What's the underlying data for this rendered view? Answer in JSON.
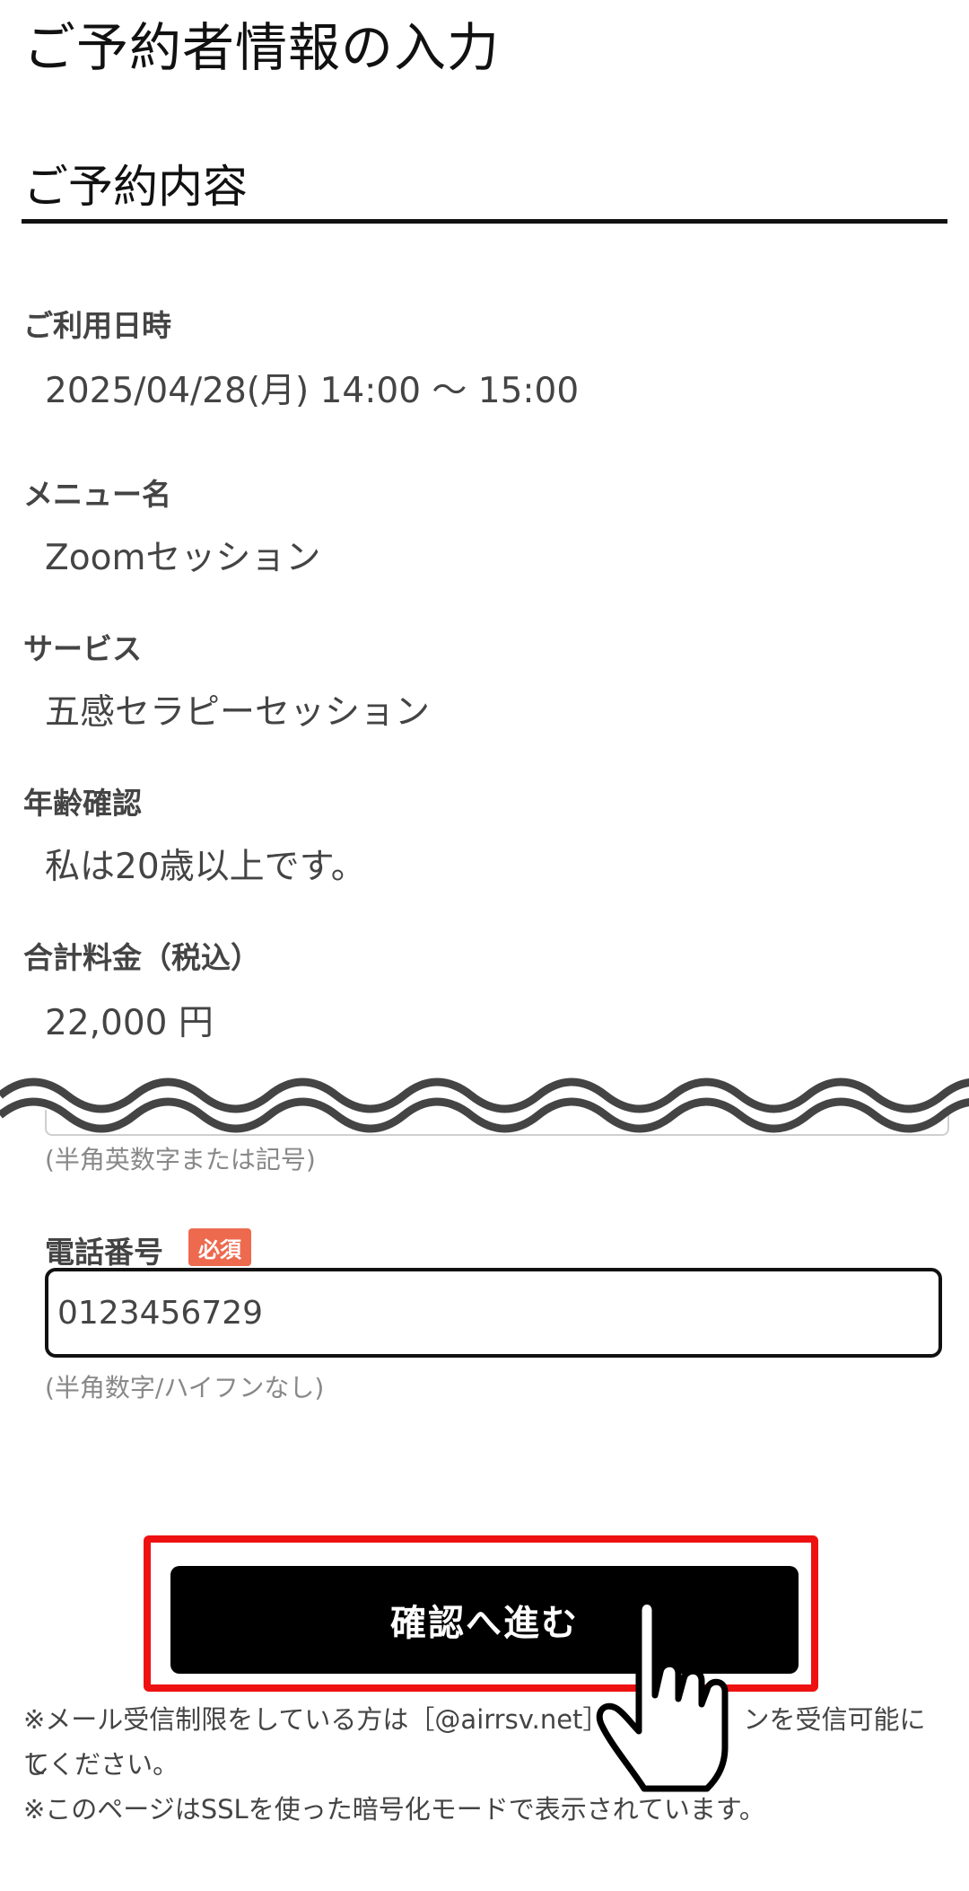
{
  "page": {
    "title": "ご予約者情報の入力"
  },
  "reservation": {
    "section_title": "ご予約内容",
    "fields": [
      {
        "label": "ご利用日時",
        "value": "2025/04/28(月) 14:00 〜 15:00"
      },
      {
        "label": "メニュー名",
        "value": "Zoomセッション"
      },
      {
        "label": "サービス",
        "value": "五感セラピーセッション"
      },
      {
        "label": "年齢確認",
        "value": "私は20歳以上です。"
      },
      {
        "label": "合計料金（税込）",
        "value": "22,000 円"
      }
    ]
  },
  "form": {
    "previous_hint": "(半角英数字または記号)",
    "phone": {
      "label": "電話番号",
      "required_badge": "必須",
      "value": "0123456729",
      "hint": "(半角数字/ハイフンなし)"
    },
    "confirm_button": "確認へ進む"
  },
  "notices": {
    "line1": "※メール受信制限をしている方は［@airrsv.net］",
    "line1_tail": "ンを受信可能にし",
    "line2": "てください。",
    "line3": "※このページはSSLを使った暗号化モードで表示されています。"
  },
  "colors": {
    "highlight": "#ee1111",
    "badge": "#ee6a4f",
    "button": "#000000"
  },
  "icons": [
    "pointing-hand-icon"
  ]
}
